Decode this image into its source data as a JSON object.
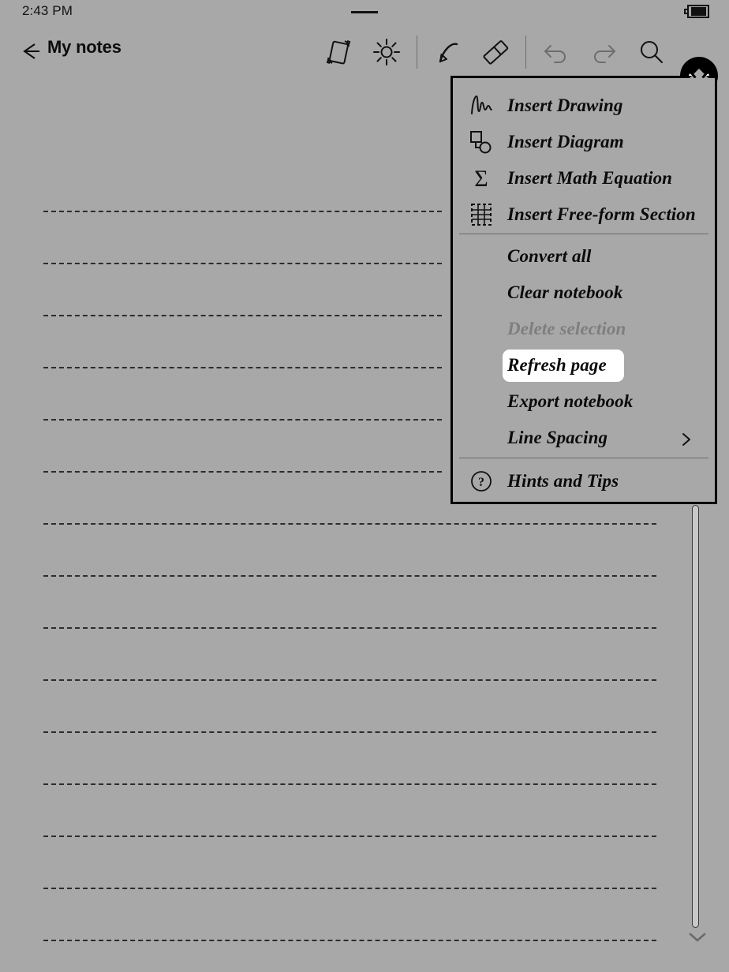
{
  "status_bar": {
    "time": "2:43 PM",
    "notch_icon": "speaker-notch",
    "battery_icon": "battery-full-icon"
  },
  "app_bar": {
    "back_icon": "back-arrow-icon",
    "title": "My notes",
    "tools": [
      {
        "name": "rotate-screen-icon",
        "label": "Rotate screen",
        "enabled": true
      },
      {
        "name": "brightness-icon",
        "label": "Brightness",
        "enabled": true
      },
      {
        "name": "pen-icon",
        "label": "Pen",
        "enabled": true
      },
      {
        "name": "eraser-icon",
        "label": "Eraser",
        "enabled": true
      },
      {
        "name": "undo-icon",
        "label": "Undo",
        "enabled": false
      },
      {
        "name": "redo-icon",
        "label": "Redo",
        "enabled": false
      },
      {
        "name": "search-icon",
        "label": "Search",
        "enabled": true
      }
    ],
    "more_button": {
      "name": "more-options-icon",
      "label": "More options",
      "active": true
    }
  },
  "more_menu": {
    "groups": [
      {
        "items": [
          {
            "icon": "insert-drawing-icon",
            "label": "Insert Drawing",
            "state": "normal"
          },
          {
            "icon": "insert-diagram-icon",
            "label": "Insert Diagram",
            "state": "normal"
          },
          {
            "icon": "insert-math-equation-icon",
            "label": "Insert Math Equation",
            "state": "normal"
          },
          {
            "icon": "insert-free-form-section-icon",
            "label": "Insert Free-form Section",
            "state": "normal"
          }
        ]
      },
      {
        "items": [
          {
            "icon": "",
            "label": "Convert all",
            "state": "normal"
          },
          {
            "icon": "",
            "label": "Clear notebook",
            "state": "normal"
          },
          {
            "icon": "",
            "label": "Delete selection",
            "state": "disabled"
          },
          {
            "icon": "",
            "label": "Refresh page",
            "state": "highlighted"
          },
          {
            "icon": "",
            "label": "Export notebook",
            "state": "normal"
          },
          {
            "icon": "",
            "label": "Line Spacing",
            "state": "submenu"
          }
        ]
      },
      {
        "items": [
          {
            "icon": "help-question-icon",
            "label": "Hints and Tips",
            "state": "normal"
          }
        ]
      }
    ]
  },
  "notebook": {
    "ruled_lines": 15,
    "line_spacing_px": 66,
    "line_color": "#2c2c2c"
  },
  "scrollbar": {
    "name": "vertical-scrollbar",
    "down_chevron_icon": "chevron-down-icon"
  },
  "colors": {
    "background": "#a8a8a8",
    "ink": "#0d0d0d",
    "disabled": "#7e7e7e",
    "highlight": "#ffffff"
  }
}
